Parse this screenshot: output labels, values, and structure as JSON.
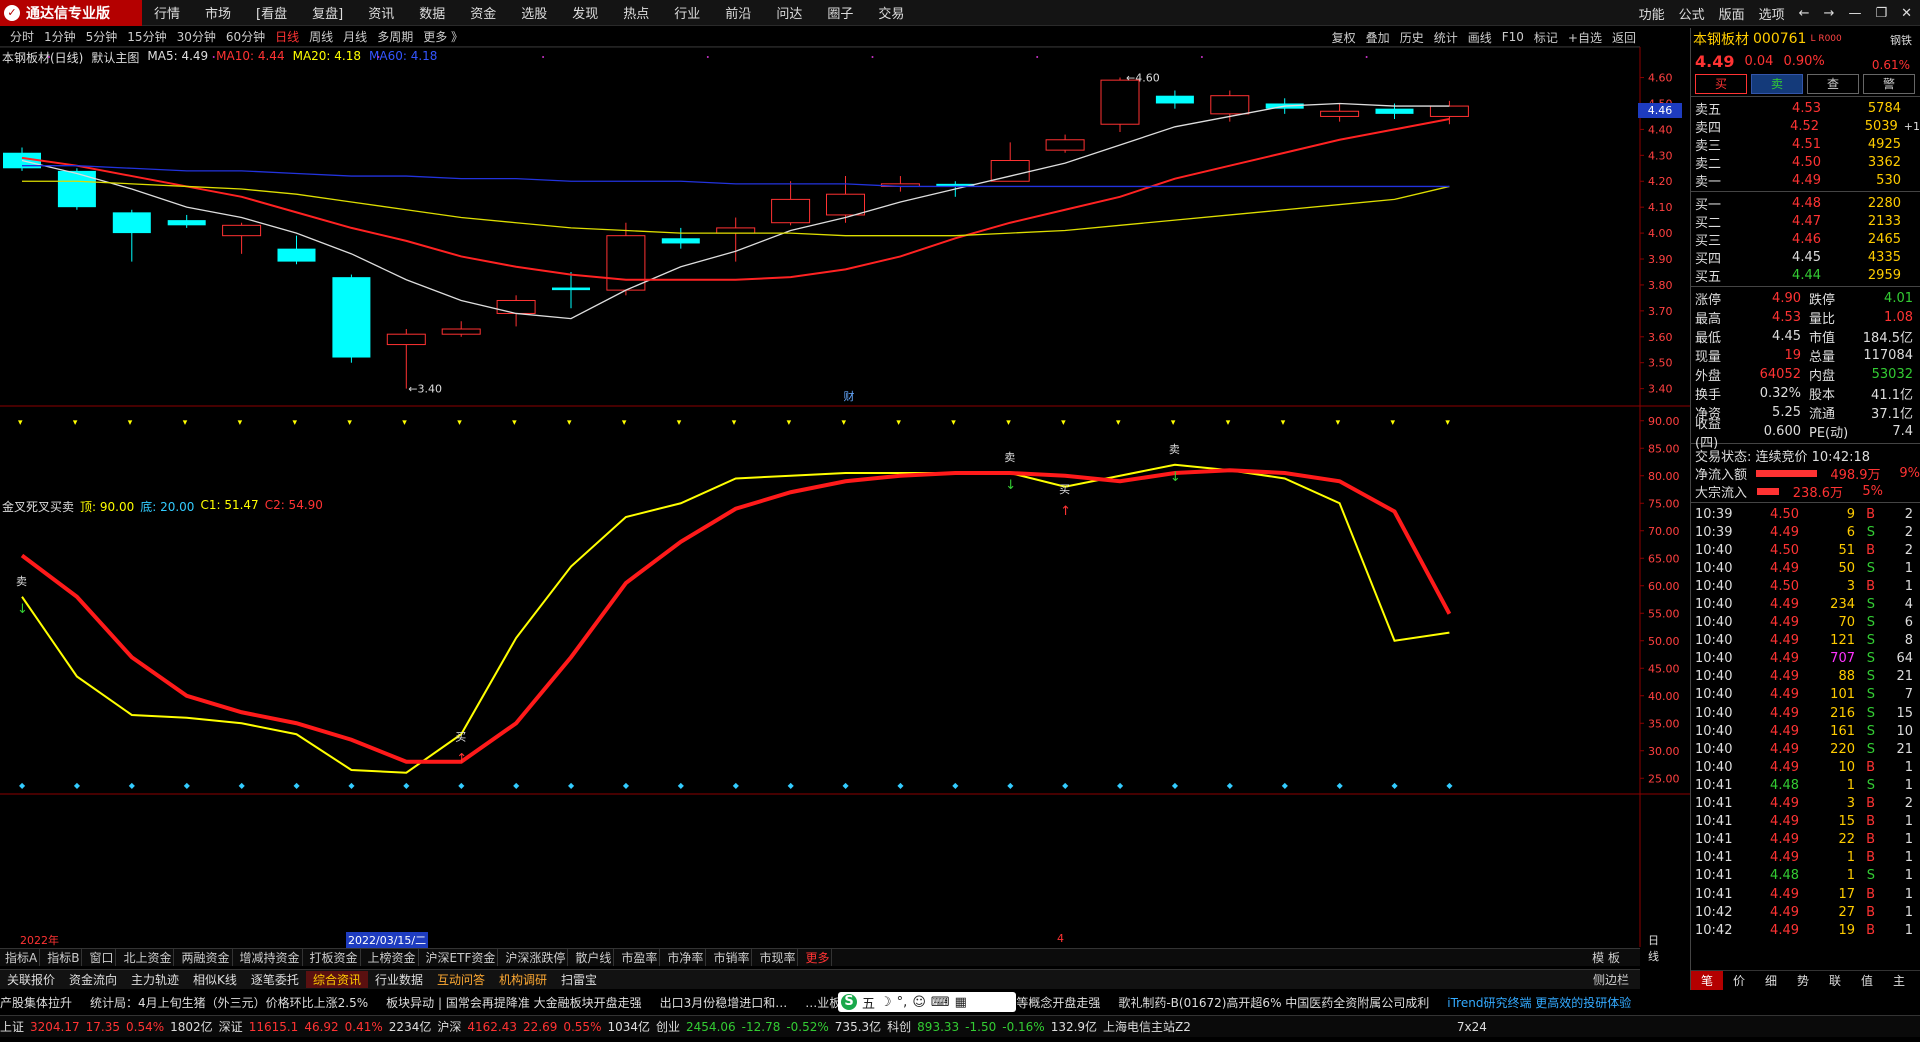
{
  "app": {
    "title": "通达信专业版",
    "menu": [
      "行情",
      "市场",
      "[看盘",
      "复盘]",
      "资讯",
      "数据",
      "资金",
      "选股",
      "发现",
      "热点",
      "行业",
      "前沿",
      "问达",
      "圈子",
      "交易"
    ],
    "right_menu": [
      "功能",
      "公式",
      "版面",
      "选项"
    ]
  },
  "period": {
    "items": [
      "分时",
      "1分钟",
      "5分钟",
      "15分钟",
      "30分钟",
      "60分钟",
      "日线",
      "周线",
      "月线",
      "多周期",
      "更多 》"
    ],
    "active": "日线"
  },
  "tools": [
    "复权",
    "叠加",
    "历史",
    "统计",
    "画线",
    "F10",
    "标记",
    "+自选",
    "返回"
  ],
  "main_legend": {
    "name": "本钢板材(日线)",
    "template": "默认主图",
    "ma5": "MA5: 4.49",
    "ma10": "MA10: 4.44",
    "ma20": "MA20: 4.18",
    "ma60": "MA60: 4.18"
  },
  "indicator_legend": {
    "name": "金叉死叉买卖",
    "top": "顶: 90.00",
    "bottom": "底: 20.00",
    "c1": "C1: 51.47",
    "c2": "C2: 54.90"
  },
  "chart_data": [
    {
      "type": "candlestick",
      "y_axis": [
        3.4,
        3.5,
        3.6,
        3.7,
        3.8,
        3.9,
        4.0,
        4.1,
        4.2,
        4.3,
        4.4,
        4.5,
        4.6
      ],
      "ylim": [
        3.36,
        4.66
      ],
      "candles": [
        [
          4.31,
          4.25,
          4.33,
          4.24
        ],
        [
          4.24,
          4.1,
          4.25,
          4.09
        ],
        [
          4.08,
          4.0,
          4.09,
          3.89
        ],
        [
          4.05,
          4.03,
          4.07,
          4.02
        ],
        [
          3.99,
          4.03,
          4.04,
          3.92
        ],
        [
          3.94,
          3.89,
          3.99,
          3.88
        ],
        [
          3.83,
          3.52,
          3.84,
          3.5
        ],
        [
          3.57,
          3.61,
          3.63,
          3.4
        ],
        [
          3.61,
          3.63,
          3.66,
          3.6
        ],
        [
          3.69,
          3.74,
          3.76,
          3.64
        ],
        [
          3.79,
          3.78,
          3.85,
          3.71
        ],
        [
          3.78,
          3.99,
          4.04,
          3.76
        ],
        [
          3.98,
          3.96,
          4.02,
          3.94
        ],
        [
          4.0,
          4.02,
          4.06,
          3.89
        ],
        [
          4.04,
          4.13,
          4.2,
          4.03
        ],
        [
          4.07,
          4.15,
          4.22,
          4.04
        ],
        [
          4.18,
          4.19,
          4.22,
          4.16
        ],
        [
          4.19,
          4.18,
          4.2,
          4.14
        ],
        [
          4.2,
          4.28,
          4.35,
          4.2
        ],
        [
          4.32,
          4.36,
          4.38,
          4.31
        ],
        [
          4.42,
          4.59,
          4.6,
          4.39
        ],
        [
          4.53,
          4.5,
          4.55,
          4.48
        ],
        [
          4.46,
          4.53,
          4.55,
          4.43
        ],
        [
          4.5,
          4.48,
          4.52,
          4.46
        ],
        [
          4.45,
          4.47,
          4.5,
          4.43
        ],
        [
          4.48,
          4.46,
          4.5,
          4.44
        ],
        [
          4.45,
          4.49,
          4.51,
          4.42
        ]
      ],
      "annotations": [
        {
          "label": "4.60",
          "value": 4.6
        },
        {
          "label": "3.40",
          "value": 3.4
        },
        {
          "label": "财"
        }
      ],
      "series": [
        {
          "name": "MA5",
          "values": [
            4.28,
            4.23,
            4.17,
            4.1,
            4.06,
            4.0,
            3.92,
            3.82,
            3.74,
            3.69,
            3.67,
            3.78,
            3.87,
            3.93,
            4.01,
            4.06,
            4.12,
            4.17,
            4.22,
            4.27,
            4.34,
            4.41,
            4.45,
            4.49,
            4.5,
            4.49,
            4.49
          ]
        },
        {
          "name": "MA10",
          "values": [
            4.29,
            4.26,
            4.22,
            4.18,
            4.14,
            4.08,
            4.02,
            3.97,
            3.91,
            3.87,
            3.84,
            3.82,
            3.82,
            3.82,
            3.83,
            3.86,
            3.91,
            3.98,
            4.04,
            4.09,
            4.14,
            4.21,
            4.26,
            4.31,
            4.36,
            4.4,
            4.44
          ]
        },
        {
          "name": "MA20",
          "values": [
            4.2,
            4.2,
            4.19,
            4.18,
            4.17,
            4.15,
            4.12,
            4.09,
            4.06,
            4.04,
            4.02,
            4.01,
            4.0,
            4.0,
            4.0,
            3.99,
            3.99,
            3.99,
            4.0,
            4.01,
            4.03,
            4.05,
            4.07,
            4.09,
            4.11,
            4.13,
            4.18
          ]
        },
        {
          "name": "MA60",
          "values": [
            4.26,
            4.26,
            4.25,
            4.24,
            4.24,
            4.23,
            4.22,
            4.22,
            4.21,
            4.21,
            4.2,
            4.2,
            4.2,
            4.19,
            4.19,
            4.19,
            4.18,
            4.18,
            4.18,
            4.18,
            4.18,
            4.18,
            4.18,
            4.18,
            4.18,
            4.18,
            4.18
          ]
        }
      ]
    },
    {
      "type": "line",
      "title": "金叉死叉买卖",
      "y_axis": [
        25,
        30,
        35,
        40,
        45,
        50,
        55,
        60,
        65,
        70,
        75,
        80,
        85,
        90
      ],
      "ylim": [
        22.5,
        92.5
      ],
      "series": [
        {
          "name": "C1",
          "values": [
            58,
            43.5,
            36.5,
            36,
            35,
            33,
            26.5,
            26,
            33,
            50.5,
            63.5,
            72.5,
            75,
            79.5,
            80,
            80.5,
            80.5,
            80.5,
            80.5,
            78,
            80,
            82,
            81,
            79.5,
            75,
            50,
            51.47
          ]
        },
        {
          "name": "C2",
          "values": [
            65.5,
            58,
            47,
            40,
            37,
            35,
            32,
            28,
            28,
            35,
            47,
            60.5,
            68,
            74,
            77,
            79,
            80,
            80.5,
            80.5,
            80,
            79,
            80.5,
            81,
            80.5,
            79,
            73.5,
            54.9
          ]
        }
      ],
      "signals": [
        {
          "index": 0,
          "label": "卖"
        },
        {
          "index": 8,
          "label": "买"
        },
        {
          "index": 18,
          "label": "卖"
        },
        {
          "index": 19,
          "label": "买"
        },
        {
          "index": 21,
          "label": "卖"
        }
      ]
    }
  ],
  "x_labels": {
    "year": "2022年",
    "date": "2022/03/15/二",
    "month": "4",
    "period": "日线"
  },
  "tabs1": [
    "指标A",
    "指标B",
    "窗口",
    "北上资金",
    "两融资金",
    "增减持资金",
    "打板资金",
    "上榜资金",
    "沪深ETF资金",
    "沪深涨跌停",
    "散户线",
    "市盈率",
    "市净率",
    "市销率",
    "市现率"
  ],
  "tabs1_more": "更多",
  "tabs1_right": "模 板",
  "tabs2": [
    "关联报价",
    "资金流向",
    "主力轨迹",
    "相似K线",
    "逐笔委托",
    "综合资讯",
    "行业数据",
    "互动问答",
    "机构调研",
    "扫雷宝"
  ],
  "tabs2_side": "侧边栏",
  "ticker": [
    "产股集体拉升",
    "统计局：4月上旬生猪（外三元）价格环比上涨2.5%",
    "板块异动 | 国常会再提降准 大金融板块开盘走强",
    "出口3月份稳增进口和…",
    "…业板指高开1%，新能源车、无人驾驶等概念开盘走强",
    "歌礼制药-B(01672)高开超6% 中国医药全资附属公司成利"
  ],
  "ticker_blue": "iTrend研究终端 更高效的投研体验",
  "status": {
    "sh": [
      "上证",
      "3204.17",
      "17.35",
      "0.54%",
      "1802亿"
    ],
    "sz": [
      "深证",
      "11615.1",
      "46.92",
      "0.41%",
      "2234亿"
    ],
    "hs": [
      "沪深",
      "4162.43",
      "22.69",
      "0.55%",
      "1034亿"
    ],
    "cy": [
      "创业",
      "2454.06",
      "-12.78",
      "-0.52%",
      "735.3亿"
    ],
    "lb": [
      "科创",
      "893.33",
      "-1.50",
      "-0.16%",
      "132.9亿"
    ],
    "server": "上海电信主站Z2",
    "clock": "7x24"
  },
  "ime": {
    "label": "五"
  },
  "quote": {
    "name": "本钢板材",
    "code": "000761",
    "flag": "L R000",
    "industry": "钢铁",
    "price": "4.49",
    "change": "0.04",
    "pct": "0.90%",
    "pct2": "0.61%",
    "btns": [
      "买",
      "卖",
      "查",
      "警"
    ],
    "asks": [
      [
        "卖五",
        "4.53",
        "5784"
      ],
      [
        "卖四",
        "4.52",
        "5039"
      ],
      [
        "卖三",
        "4.51",
        "4925"
      ],
      [
        "卖二",
        "4.50",
        "3362"
      ],
      [
        "卖一",
        "4.49",
        "530"
      ]
    ],
    "ask_delta": "+1",
    "bids": [
      [
        "买一",
        "4.48",
        "2280"
      ],
      [
        "买二",
        "4.47",
        "2133"
      ],
      [
        "买三",
        "4.46",
        "2465"
      ],
      [
        "买四",
        "4.45",
        "4335"
      ],
      [
        "买五",
        "4.44",
        "2959"
      ]
    ],
    "stats": [
      [
        "涨停",
        "4.90",
        "跌停",
        "4.01"
      ],
      [
        "最高",
        "4.53",
        "量比",
        "1.08"
      ],
      [
        "最低",
        "4.45",
        "市值",
        "184.5亿"
      ],
      [
        "现量",
        "19",
        "总量",
        "117084"
      ],
      [
        "外盘",
        "64052",
        "内盘",
        "53032"
      ],
      [
        "换手",
        "0.32%",
        "股本",
        "41.1亿"
      ],
      [
        "净资",
        "5.25",
        "流通",
        "37.1亿"
      ],
      [
        "收益(四)",
        "0.600",
        "PE(动)",
        "7.4"
      ]
    ],
    "trade_status": "交易状态: 连续竞价 10:42:18",
    "flows": [
      [
        "净流入额",
        "498.9万",
        "9%"
      ],
      [
        "大宗流入",
        "238.6万",
        "5%"
      ]
    ],
    "price_tag": "4.46",
    "ticks": [
      [
        "10:39",
        "4.50",
        "9",
        "B",
        "2"
      ],
      [
        "10:39",
        "4.49",
        "6",
        "S",
        "2"
      ],
      [
        "10:40",
        "4.50",
        "51",
        "B",
        "2"
      ],
      [
        "10:40",
        "4.49",
        "50",
        "S",
        "1"
      ],
      [
        "10:40",
        "4.50",
        "3",
        "B",
        "1"
      ],
      [
        "10:40",
        "4.49",
        "234",
        "S",
        "4"
      ],
      [
        "10:40",
        "4.49",
        "70",
        "S",
        "6"
      ],
      [
        "10:40",
        "4.49",
        "121",
        "S",
        "8"
      ],
      [
        "10:40",
        "4.49",
        "707",
        "S",
        "64"
      ],
      [
        "10:40",
        "4.49",
        "88",
        "S",
        "21"
      ],
      [
        "10:40",
        "4.49",
        "101",
        "S",
        "7"
      ],
      [
        "10:40",
        "4.49",
        "216",
        "S",
        "15"
      ],
      [
        "10:40",
        "4.49",
        "161",
        "S",
        "10"
      ],
      [
        "10:40",
        "4.49",
        "220",
        "S",
        "21"
      ],
      [
        "10:40",
        "4.49",
        "10",
        "B",
        "1"
      ],
      [
        "10:41",
        "4.48",
        "1",
        "S",
        "1"
      ],
      [
        "10:41",
        "4.49",
        "3",
        "B",
        "2"
      ],
      [
        "10:41",
        "4.49",
        "15",
        "B",
        "1"
      ],
      [
        "10:41",
        "4.49",
        "22",
        "B",
        "1"
      ],
      [
        "10:41",
        "4.49",
        "1",
        "B",
        "1"
      ],
      [
        "10:41",
        "4.48",
        "1",
        "S",
        "1"
      ],
      [
        "10:41",
        "4.49",
        "17",
        "B",
        "1"
      ],
      [
        "10:42",
        "4.49",
        "27",
        "B",
        "1"
      ],
      [
        "10:42",
        "4.49",
        "19",
        "B",
        "1"
      ]
    ],
    "bottom_tabs": [
      "笔",
      "价",
      "细",
      "势",
      "联",
      "值",
      "主"
    ]
  }
}
